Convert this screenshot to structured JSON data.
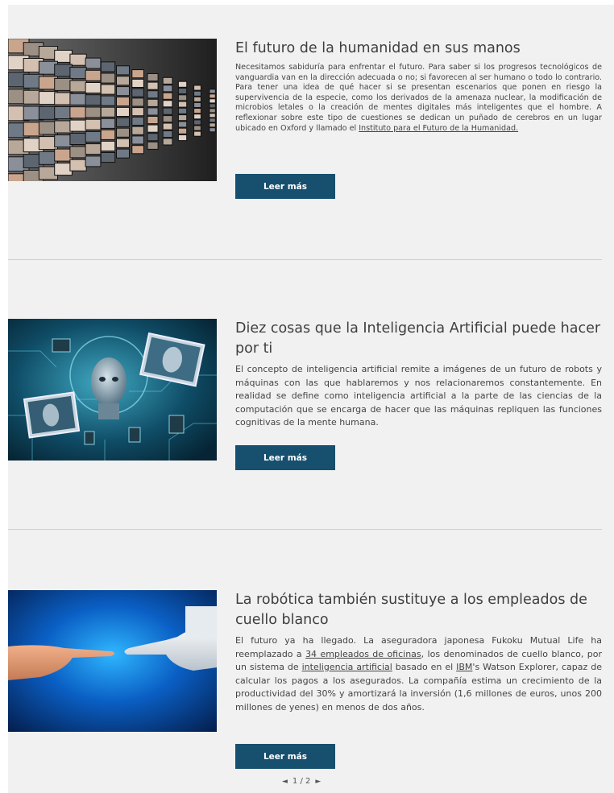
{
  "articles": [
    {
      "title": "El futuro de la humanidad en sus manos",
      "body_before_link": "Necesitamos sabiduría para enfrentar el futuro. Para saber si los progresos tecnológicos de vanguardia van en la dirección adecuada o no; si favorecen al ser humano o todo lo contrario. Para tener una idea de qué hacer si se presentan escenarios que ponen en riesgo la supervivencia de la especie, como los derivados de la amenaza nuclear, la modificación de microbios letales o la creación de mentes digitales más inteligentes que el hombre. A reflexionar sobre este tipo de cuestiones se dedican un puñado de cerebros en un lugar ubicado en Oxford y llamado el ",
      "link": "Instituto para el Futuro de la Humanidad.",
      "read_more": "Leer más"
    },
    {
      "title": "Diez cosas que la Inteligencia Artificial puede hacer por ti",
      "body": "El concepto de inteligencia artificial remite a imágenes de un futuro de robots y máquinas con las que hablaremos y nos relacionaremos constantemente. En realidad se define como inteligencia artificial a la parte de las ciencias de la computación que se encarga de hacer que las máquinas repliquen las funciones cognitivas de la mente humana.",
      "read_more": "Leer más"
    },
    {
      "title": "La robótica también sustituye a los empleados de cuello blanco",
      "body_part1": "El futuro ya ha llegado. La aseguradora japonesa Fukoku Mutual Life ha reemplazado a ",
      "link1": "34 empleados de oficinas",
      "body_part2": ", los denominados de cuello blanco, por un sistema de ",
      "link2": "inteligencia artificial",
      "body_part3": " basado en el ",
      "link3": "IBM",
      "body_part4": "'s Watson Explorer, capaz de calcular los pagos a los asegurados. La compañía estima un crecimiento de la productividad del 30% y amortizará la inversión (1,6 millones de euros, unos 200 millones de yenes) en menos de dos años.",
      "read_more": "Leer más"
    }
  ],
  "pagination": {
    "prev_icon": "◄",
    "label": "1 / 2",
    "next_icon": "►"
  }
}
